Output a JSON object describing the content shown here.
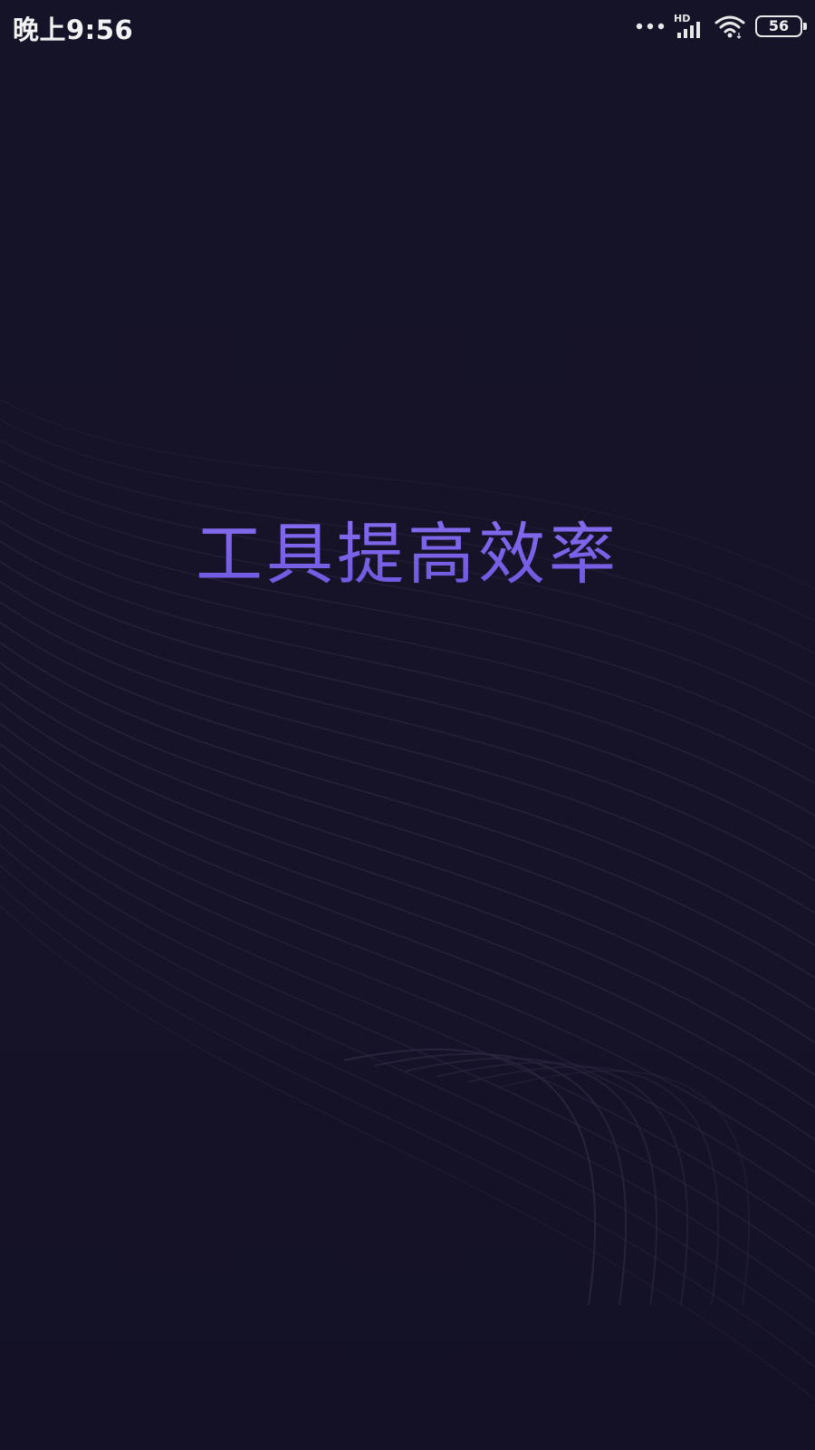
{
  "status_bar": {
    "time": "晚上9:56",
    "network_badge": "HD",
    "battery_level": "56",
    "icons": [
      "more-dots-icon",
      "signal-icon",
      "wifi-icon",
      "battery-icon"
    ]
  },
  "splash": {
    "slogan": "工具提高效率"
  },
  "colors": {
    "background": "#15132a",
    "slogan_accent": "#7a62e6",
    "status_text": "#f2f2f2"
  }
}
